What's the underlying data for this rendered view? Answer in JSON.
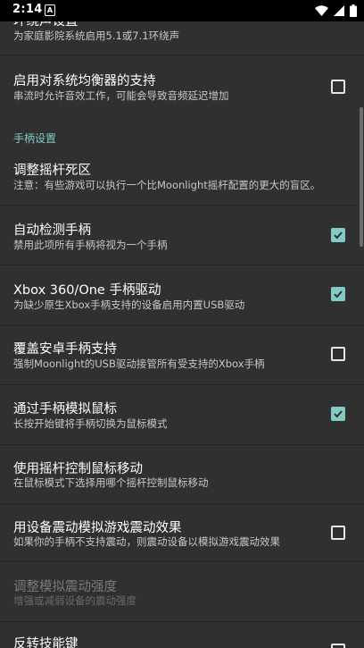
{
  "status_bar": {
    "time": "2:14",
    "notification_glyph": "A"
  },
  "icons": {
    "wifi": "wifi-icon",
    "signal": "cell-signal-icon",
    "battery": "battery-icon",
    "check": "check-icon"
  },
  "colors": {
    "accent": "#80cbc4",
    "background": "#303030",
    "status_bar": "#000000"
  },
  "prefs": {
    "surround": {
      "title": "环绕声设置",
      "summary": "为家庭影院系统启用5.1或7.1环绕声"
    },
    "system_eq": {
      "title": "启用对系统均衡器的支持",
      "summary": "串流时允许音效工作，可能会导致音频延迟增加",
      "checked": false
    },
    "gamepad_category": "手柄设置",
    "deadzone": {
      "title": "调整摇杆死区",
      "summary": "注意：有些游戏可以执行一个比Moonlight摇杆配置的更大的盲区。"
    },
    "auto_detect": {
      "title": "自动检测手柄",
      "summary": "禁用此项所有手柄将视为一个手柄",
      "checked": true
    },
    "xbox_driver": {
      "title": "Xbox 360/One 手柄驱动",
      "summary": "为缺少原生Xbox手柄支持的设备启用内置USB驱动",
      "checked": true
    },
    "override_android": {
      "title": "覆盖安卓手柄支持",
      "summary": "强制Moonlight的USB驱动接管所有受支持的Xbox手柄",
      "checked": false
    },
    "mouse_emulation": {
      "title": "通过手柄模拟鼠标",
      "summary": "长按开始键将手柄切换为鼠标模式",
      "checked": true
    },
    "stick_mouse": {
      "title": "使用摇杆控制鼠标移动",
      "summary": "在鼠标模式下选择用哪个摇杆控制鼠标移动"
    },
    "rumble_emulation": {
      "title": "用设备震动模拟游戏震动效果",
      "summary": "如果你的手柄不支持震动，则震动设备以模拟游戏震动效果",
      "checked": false
    },
    "rumble_strength": {
      "title": "调整模拟震动强度",
      "summary": "增强或减弱设备的震动强度"
    },
    "flip_face": {
      "title": "反转技能键",
      "checked": false
    }
  }
}
